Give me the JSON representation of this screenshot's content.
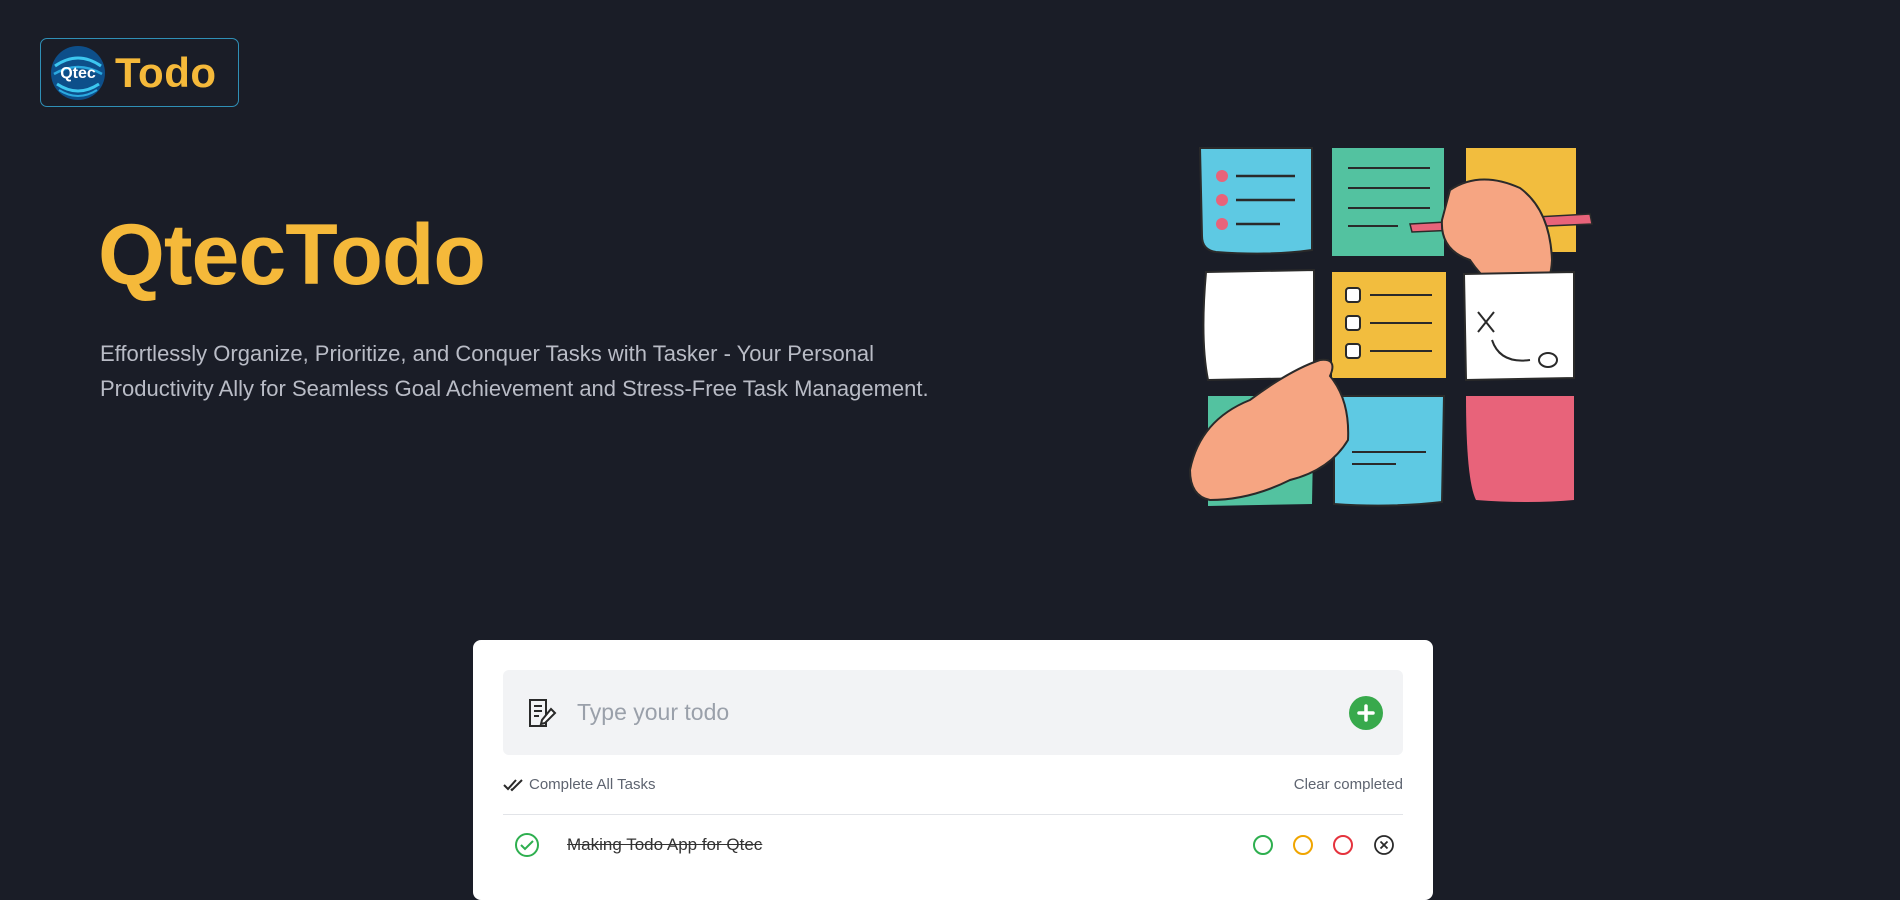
{
  "logo": {
    "badge_text": "Qtec",
    "title": "Todo"
  },
  "hero": {
    "title": "QtecTodo",
    "subtitle": "Effortlessly Organize, Prioritize, and Conquer Tasks with Tasker - Your Personal Productivity Ally for Seamless Goal Achievement and Stress-Free Task Management."
  },
  "todo": {
    "input_placeholder": "Type your todo",
    "input_value": "",
    "complete_all_label": "Complete All Tasks",
    "clear_completed_label": "Clear completed",
    "tasks": [
      {
        "text": "Making Todo App for Qtec",
        "completed": true
      }
    ]
  },
  "colors": {
    "background": "#1a1d27",
    "accent": "#f5b93a",
    "add_button": "#38a94c",
    "priority_low": "#2eaf4f",
    "priority_medium": "#f0a500",
    "priority_high": "#e5333d"
  },
  "icons": {
    "note": "edit-note-icon",
    "add": "plus-circle-icon",
    "complete_all": "double-check-icon",
    "task_done": "check-circle-icon",
    "remove": "close-circle-icon"
  }
}
